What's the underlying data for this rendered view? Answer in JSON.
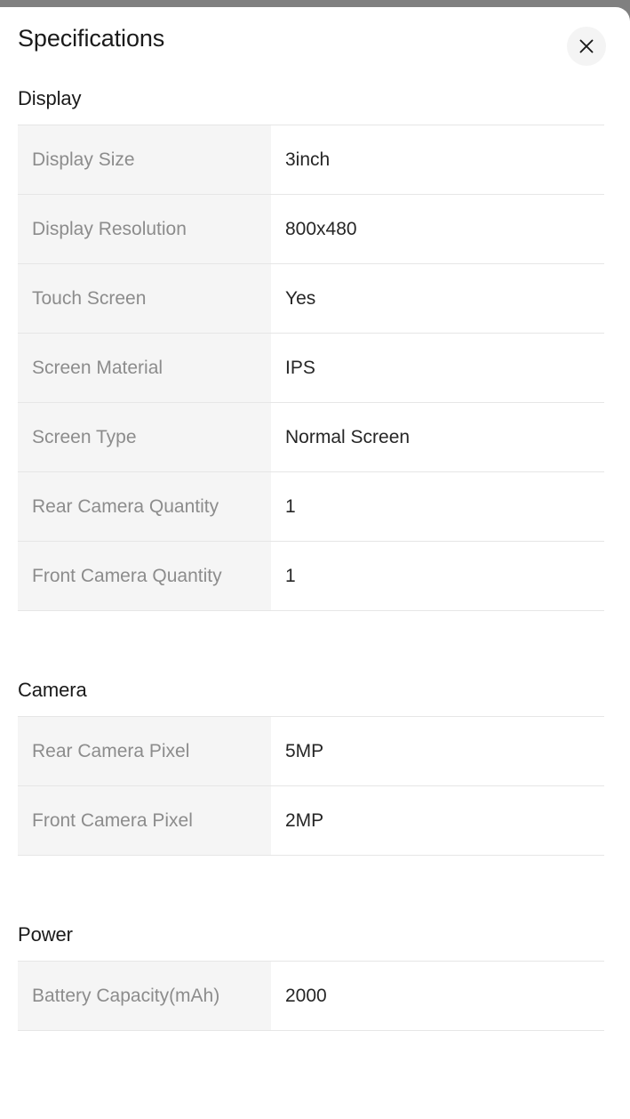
{
  "modal": {
    "title": "Specifications",
    "close_icon": "close-icon",
    "close_label": "Close"
  },
  "colors": {
    "backdrop": "#808080",
    "panel": "#ffffff",
    "label_bg": "#f5f5f5",
    "label_text": "#8c8c8c",
    "value_text": "#262626",
    "heading_text": "#1a1a1a",
    "divider": "#e6e6e6",
    "close_bg": "#f4f4f4"
  },
  "sections": [
    {
      "heading": "Display",
      "rows": [
        {
          "label": "Display Size",
          "value": "3inch"
        },
        {
          "label": "Display Resolution",
          "value": "800x480"
        },
        {
          "label": "Touch Screen",
          "value": "Yes"
        },
        {
          "label": "Screen Material",
          "value": "IPS"
        },
        {
          "label": "Screen Type",
          "value": "Normal Screen"
        },
        {
          "label": "Rear Camera Quantity",
          "value": "1"
        },
        {
          "label": "Front Camera Quantity",
          "value": "1"
        }
      ]
    },
    {
      "heading": "Camera",
      "rows": [
        {
          "label": "Rear Camera Pixel",
          "value": "5MP"
        },
        {
          "label": "Front Camera Pixel",
          "value": "2MP"
        }
      ]
    },
    {
      "heading": "Power",
      "rows": [
        {
          "label": "Battery Capacity(mAh)",
          "value": "2000"
        }
      ]
    }
  ]
}
